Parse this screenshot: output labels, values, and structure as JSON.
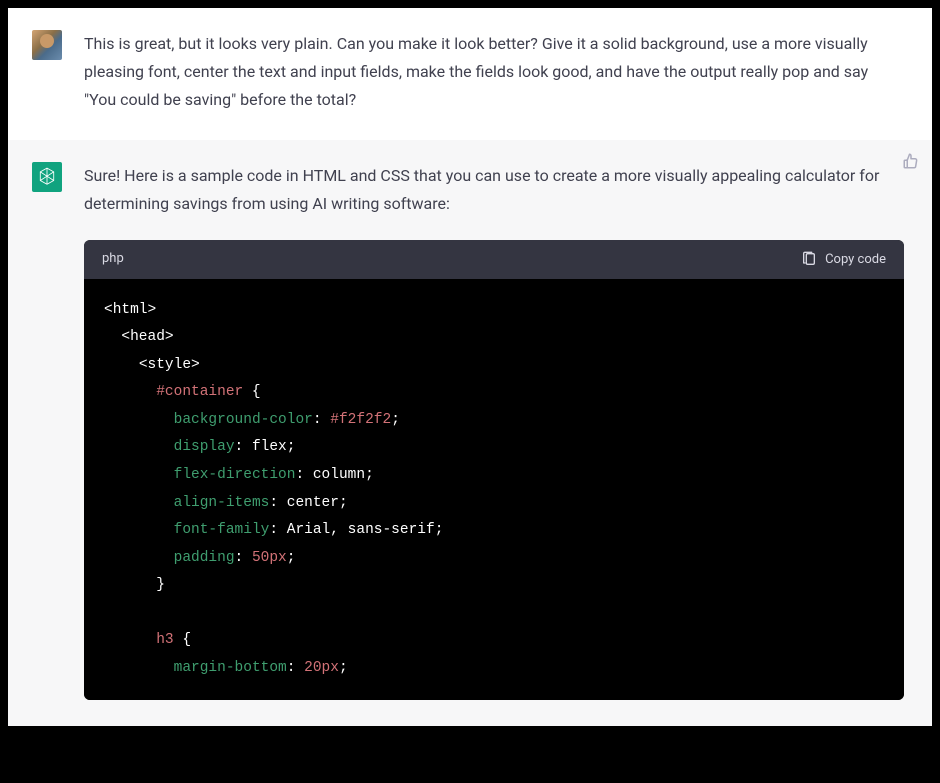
{
  "user": {
    "text": "This is great, but it looks very plain. Can you make it look better? Give it a solid background, use a more visually pleasing font, center the text and input fields, make the fields look good, and have the output really pop and say \"You could be saving\" before the total?"
  },
  "assistant": {
    "intro": "Sure! Here is a sample code in HTML and CSS that you can use to create a more visually appealing calculator for determining savings from using AI writing software:",
    "code": {
      "language": "php",
      "copy_label": "Copy code",
      "tokens": {
        "t_html_open": "<html>",
        "t_head_open": "<head>",
        "t_style_open": "<style>",
        "sel_container": "#container",
        "brace_open": " {",
        "prop_bg": "background-color",
        "val_bg": "#f2f2f2",
        "prop_display": "display",
        "val_display": "flex",
        "prop_flexdir": "flex-direction",
        "val_flexdir": "column",
        "prop_align": "align-items",
        "val_align": "center",
        "prop_font": "font-family",
        "val_font": "Arial, sans-serif",
        "prop_padding": "padding",
        "val_padding": "50px",
        "brace_close": "}",
        "sel_h3": "h3",
        "prop_mb": "margin-bottom",
        "val_mb": "20px",
        "colon": ": ",
        "semi": ";"
      }
    }
  }
}
